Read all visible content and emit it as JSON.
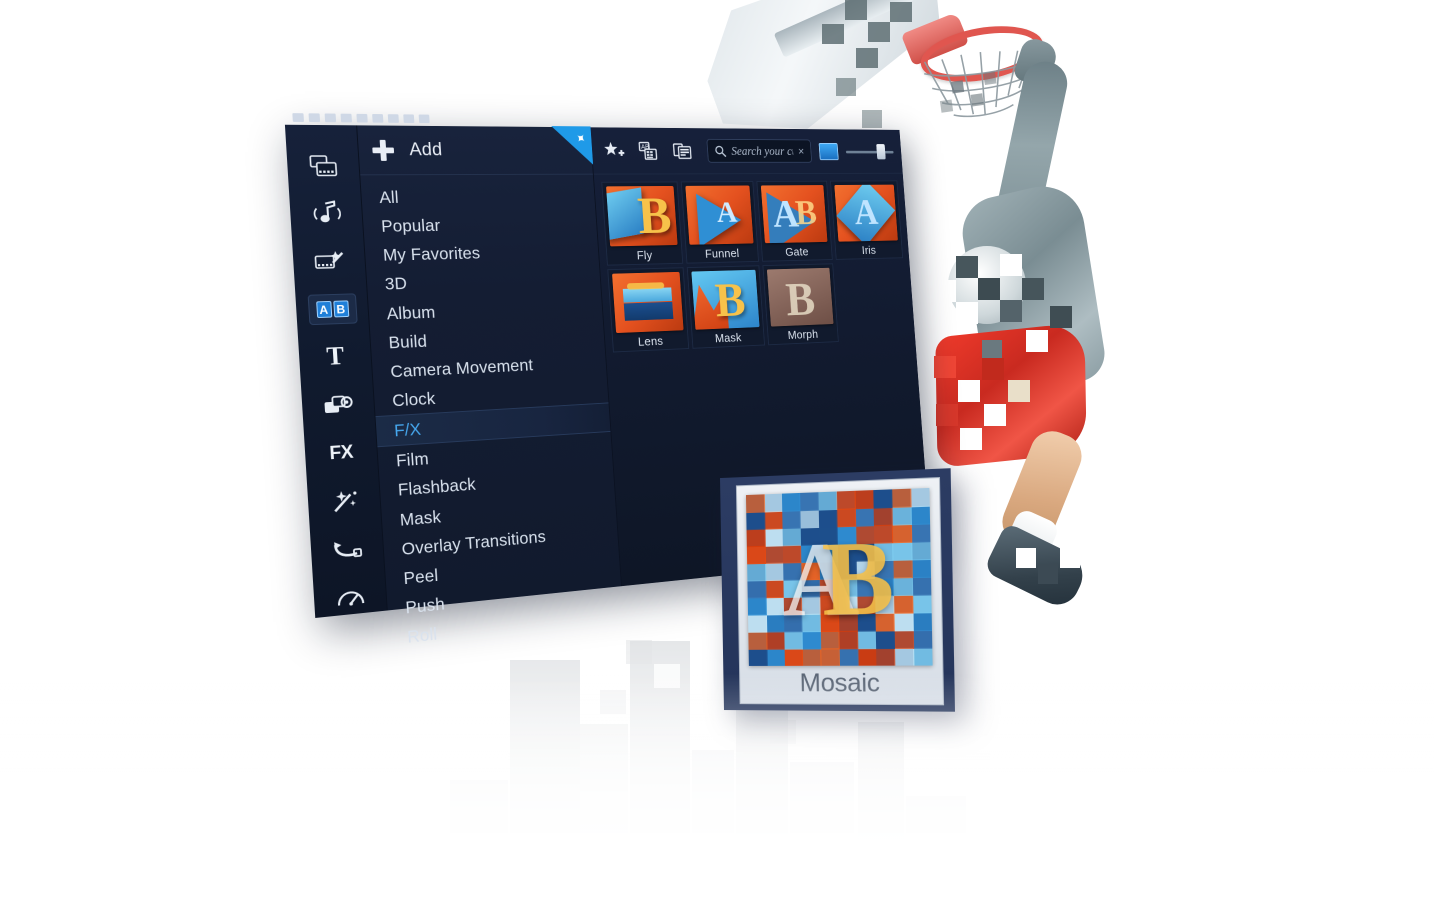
{
  "app": {
    "add_label": "Add",
    "pin_icon": "pin-icon",
    "plus_icon": "plus-icon"
  },
  "rail": {
    "items": [
      {
        "name": "media-room",
        "icon": "media-clips-icon"
      },
      {
        "name": "audio-room",
        "icon": "music-note-icon"
      },
      {
        "name": "video-effects-room",
        "icon": "film-wand-icon"
      },
      {
        "name": "transitions-room",
        "icon": "ab-transition-icon",
        "label_a": "A",
        "label_b": "B",
        "active": true
      },
      {
        "name": "title-room",
        "icon": "title-t-icon"
      },
      {
        "name": "overlay-room",
        "icon": "overlay-shapes-icon"
      },
      {
        "name": "effects-room",
        "icon": "fx-icon",
        "label": "FX"
      },
      {
        "name": "particle-room",
        "icon": "magic-wand-sparkle-icon"
      },
      {
        "name": "path-room",
        "icon": "motion-path-icon"
      },
      {
        "name": "speed-room",
        "icon": "speed-gauge-icon"
      }
    ]
  },
  "menu": {
    "items": [
      {
        "label": "All",
        "selected": false
      },
      {
        "label": "Popular",
        "selected": false
      },
      {
        "label": "My Favorites",
        "selected": false
      },
      {
        "label": "3D",
        "selected": false
      },
      {
        "label": "Album",
        "selected": false
      },
      {
        "label": "Build",
        "selected": false
      },
      {
        "label": "Camera Movement",
        "selected": false
      },
      {
        "label": "Clock",
        "selected": false
      },
      {
        "label": "F/X",
        "selected": true
      },
      {
        "label": "Film",
        "selected": false
      },
      {
        "label": "Flashback",
        "selected": false
      },
      {
        "label": "Mask",
        "selected": false
      },
      {
        "label": "Overlay Transitions",
        "selected": false
      },
      {
        "label": "Peel",
        "selected": false
      },
      {
        "label": "Push",
        "selected": false
      },
      {
        "label": "Roll",
        "selected": false
      }
    ]
  },
  "toolbar": {
    "icons": [
      {
        "name": "add-to-favorites-icon",
        "glyph": "star-plus"
      },
      {
        "name": "detail-view-icon",
        "glyph": "ab-grid"
      },
      {
        "name": "list-view-icon",
        "glyph": "layout-grid"
      }
    ],
    "search": {
      "placeholder": "Search your current view",
      "value": "",
      "search_icon": "search-icon",
      "clear_icon": "clear-x-icon"
    },
    "display_icon": "monitor-preview-icon",
    "zoom_slider": {
      "name": "thumbnail-size-slider",
      "value": 65
    }
  },
  "grid": {
    "items": [
      {
        "label": "Fly",
        "style": "fly"
      },
      {
        "label": "Funnel",
        "style": "funnel"
      },
      {
        "label": "Gate",
        "style": "gate"
      },
      {
        "label": "Iris",
        "style": "iris"
      },
      {
        "label": "Lens",
        "style": "lens"
      },
      {
        "label": "Mask",
        "style": "mask"
      },
      {
        "label": "Morph",
        "style": "morph"
      }
    ]
  },
  "preview": {
    "title": "Mosaic",
    "letter_a": "A",
    "letter_b": "B"
  },
  "colors": {
    "accent_blue": "#1f9ae8",
    "selected_text": "#46a8ef",
    "panel_bg": "#141d33",
    "thumb_orange": "#e4511f",
    "thumb_blue": "#2f8fd4",
    "letter_yellow": "#f7c24a"
  }
}
